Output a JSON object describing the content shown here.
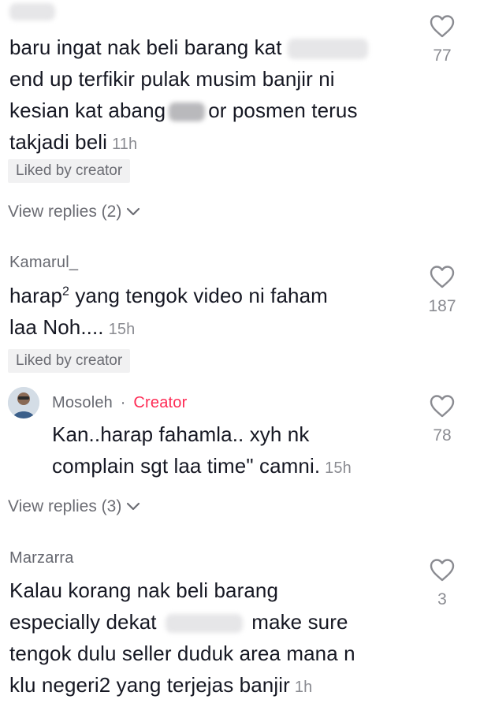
{
  "comments": [
    {
      "text_lines": [
        "baru ingat nak beli barang kat",
        "end up terfikir pulak musim banjir ni",
        "kesian kat abang",
        "or posmen terus",
        "takjadi beli"
      ],
      "time": "11h",
      "liked_badge": "Liked by creator",
      "likes": "77",
      "view_replies": "View replies (2)"
    },
    {
      "username": "Kamarul_",
      "text_line1_before": "harap",
      "text_line1_sup": "2",
      "text_line1_after": " yang tengok video ni faham",
      "text_line2": "laa Noh....",
      "time": "15h",
      "liked_badge": "Liked by creator",
      "likes": "187"
    },
    {
      "username": "Mosoleh",
      "separator": "·",
      "creator_label": "Creator",
      "text_lines": [
        "Kan..harap fahamla.. xyh nk",
        "complain sgt laa time\" camni."
      ],
      "time": "15h",
      "likes": "78",
      "view_replies": "View replies (3)"
    },
    {
      "username": "Marzarra",
      "text_lines": [
        "Kalau korang nak beli barang",
        "especially dekat",
        "make sure",
        "tengok dulu seller duduk area mana n",
        "klu negeri2 yang terjejas banjir"
      ],
      "time": "1h",
      "likes": "3"
    }
  ],
  "icons": {
    "like": "heart-outline-icon",
    "expand": "chevron-down-icon"
  },
  "colors": {
    "creator": "#fe2c55",
    "muted": "#8a8b91",
    "badge_bg": "#f1f1f2"
  }
}
